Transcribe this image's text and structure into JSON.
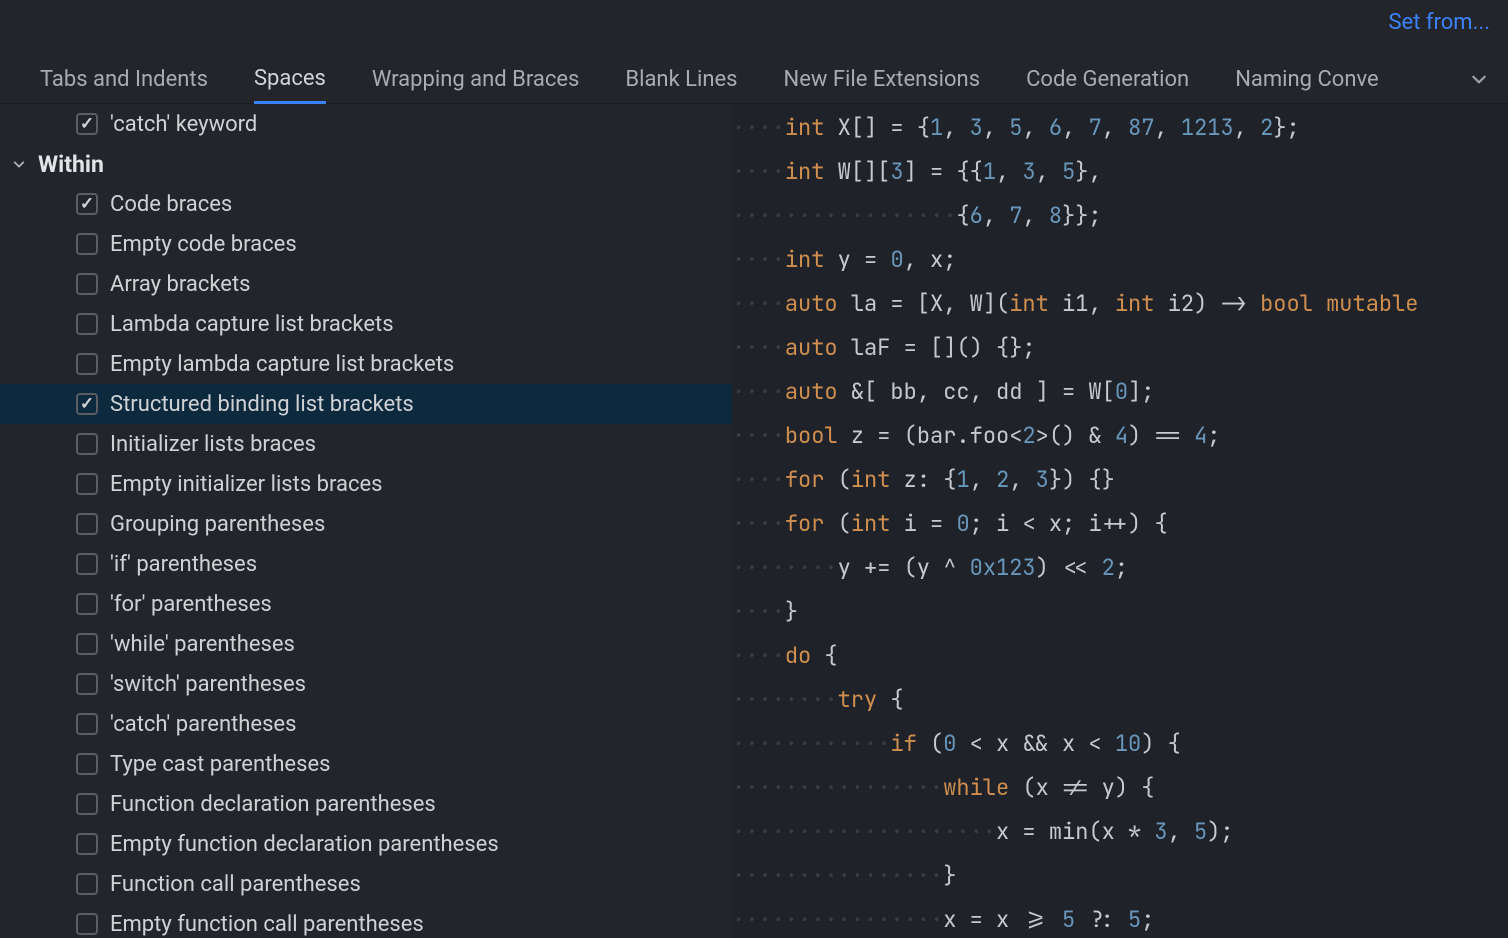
{
  "top_link": "Set from...",
  "tabs": [
    {
      "label": "Tabs and Indents",
      "active": false
    },
    {
      "label": "Spaces",
      "active": true
    },
    {
      "label": "Wrapping and Braces",
      "active": false
    },
    {
      "label": "Blank Lines",
      "active": false
    },
    {
      "label": "New File Extensions",
      "active": false
    },
    {
      "label": "Code Generation",
      "active": false
    },
    {
      "label": "Naming Conve",
      "active": false
    }
  ],
  "pre_section_option": {
    "label": "'catch' keyword",
    "checked": true
  },
  "section": {
    "label": "Within"
  },
  "options": [
    {
      "label": "Code braces",
      "checked": true,
      "selected": false
    },
    {
      "label": "Empty code braces",
      "checked": false,
      "selected": false
    },
    {
      "label": "Array brackets",
      "checked": false,
      "selected": false
    },
    {
      "label": "Lambda capture list brackets",
      "checked": false,
      "selected": false
    },
    {
      "label": "Empty lambda capture list brackets",
      "checked": false,
      "selected": false
    },
    {
      "label": "Structured binding list brackets",
      "checked": true,
      "selected": true
    },
    {
      "label": "Initializer lists braces",
      "checked": false,
      "selected": false
    },
    {
      "label": "Empty initializer lists braces",
      "checked": false,
      "selected": false
    },
    {
      "label": "Grouping parentheses",
      "checked": false,
      "selected": false
    },
    {
      "label": "'if' parentheses",
      "checked": false,
      "selected": false
    },
    {
      "label": "'for' parentheses",
      "checked": false,
      "selected": false
    },
    {
      "label": "'while' parentheses",
      "checked": false,
      "selected": false
    },
    {
      "label": "'switch' parentheses",
      "checked": false,
      "selected": false
    },
    {
      "label": "'catch' parentheses",
      "checked": false,
      "selected": false
    },
    {
      "label": "Type cast parentheses",
      "checked": false,
      "selected": false
    },
    {
      "label": "Function declaration parentheses",
      "checked": false,
      "selected": false
    },
    {
      "label": "Empty function declaration parentheses",
      "checked": false,
      "selected": false
    },
    {
      "label": "Function call parentheses",
      "checked": false,
      "selected": false
    },
    {
      "label": "Empty function call parentheses",
      "checked": false,
      "selected": false
    }
  ],
  "code": [
    [
      {
        "ws": "····"
      },
      {
        "kw": "int"
      },
      {
        "pn": " X[] = {"
      },
      {
        "nm": "1"
      },
      {
        "pn": ", "
      },
      {
        "nm": "3"
      },
      {
        "pn": ", "
      },
      {
        "nm": "5"
      },
      {
        "pn": ", "
      },
      {
        "nm": "6"
      },
      {
        "pn": ", "
      },
      {
        "nm": "7"
      },
      {
        "pn": ", "
      },
      {
        "nm": "87"
      },
      {
        "pn": ", "
      },
      {
        "nm": "1213"
      },
      {
        "pn": ", "
      },
      {
        "nm": "2"
      },
      {
        "pn": "};"
      }
    ],
    [
      {
        "ws": "····"
      },
      {
        "kw": "int"
      },
      {
        "pn": " W[]["
      },
      {
        "nm": "3"
      },
      {
        "pn": "] = {{"
      },
      {
        "nm": "1"
      },
      {
        "pn": ", "
      },
      {
        "nm": "3"
      },
      {
        "pn": ", "
      },
      {
        "nm": "5"
      },
      {
        "pn": "},"
      }
    ],
    [
      {
        "ws": "·················"
      },
      {
        "pn": "{"
      },
      {
        "nm": "6"
      },
      {
        "pn": ", "
      },
      {
        "nm": "7"
      },
      {
        "pn": ", "
      },
      {
        "nm": "8"
      },
      {
        "pn": "}};"
      }
    ],
    [
      {
        "ws": "····"
      },
      {
        "kw": "int"
      },
      {
        "pn": " y = "
      },
      {
        "nm": "0"
      },
      {
        "pn": ", x;"
      }
    ],
    [
      {
        "ws": "····"
      },
      {
        "kw": "auto"
      },
      {
        "pn": " la = [X, W]("
      },
      {
        "kw": "int"
      },
      {
        "pn": " i1, "
      },
      {
        "kw": "int"
      },
      {
        "pn": " i2) -> "
      },
      {
        "kw": "bool"
      },
      {
        "pn": " "
      },
      {
        "kw": "mutable"
      }
    ],
    [
      {
        "ws": "····"
      },
      {
        "kw": "auto"
      },
      {
        "pn": " laF = []() {};"
      }
    ],
    [
      {
        "ws": "····"
      },
      {
        "kw": "auto"
      },
      {
        "pn": " &[ bb, cc, dd ] = W["
      },
      {
        "nm": "0"
      },
      {
        "pn": "];"
      }
    ],
    [
      {
        "ws": "····"
      },
      {
        "kw": "bool"
      },
      {
        "pn": " z = (bar.foo<"
      },
      {
        "nm": "2"
      },
      {
        "pn": ">() & "
      },
      {
        "nm": "4"
      },
      {
        "pn": ") == "
      },
      {
        "nm": "4"
      },
      {
        "pn": ";"
      }
    ],
    [
      {
        "ws": "····"
      },
      {
        "kw": "for"
      },
      {
        "pn": " ("
      },
      {
        "kw": "int"
      },
      {
        "pn": " z: {"
      },
      {
        "nm": "1"
      },
      {
        "pn": ", "
      },
      {
        "nm": "2"
      },
      {
        "pn": ", "
      },
      {
        "nm": "3"
      },
      {
        "pn": "}) {}"
      }
    ],
    [
      {
        "ws": "····"
      },
      {
        "kw": "for"
      },
      {
        "pn": " ("
      },
      {
        "kw": "int"
      },
      {
        "pn": " i = "
      },
      {
        "nm": "0"
      },
      {
        "pn": "; i < x; i++) {"
      }
    ],
    [
      {
        "ws": "········"
      },
      {
        "pn": "y += (y ^ "
      },
      {
        "nm": "0x123"
      },
      {
        "pn": ") << "
      },
      {
        "nm": "2"
      },
      {
        "pn": ";"
      }
    ],
    [
      {
        "ws": "····"
      },
      {
        "pn": "}"
      }
    ],
    [
      {
        "ws": "····"
      },
      {
        "kw": "do"
      },
      {
        "pn": " {"
      }
    ],
    [
      {
        "ws": "········"
      },
      {
        "kw": "try"
      },
      {
        "pn": " {"
      }
    ],
    [
      {
        "ws": "············"
      },
      {
        "kw": "if"
      },
      {
        "pn": " ("
      },
      {
        "nm": "0"
      },
      {
        "pn": " < x && x < "
      },
      {
        "nm": "10"
      },
      {
        "pn": ") {"
      }
    ],
    [
      {
        "ws": "················"
      },
      {
        "kw": "while"
      },
      {
        "pn": " (x != y) {"
      }
    ],
    [
      {
        "ws": "····················"
      },
      {
        "pn": "x = min(x * "
      },
      {
        "nm": "3"
      },
      {
        "pn": ", "
      },
      {
        "nm": "5"
      },
      {
        "pn": ");"
      }
    ],
    [
      {
        "ws": "················"
      },
      {
        "pn": "}"
      }
    ],
    [
      {
        "ws": "················"
      },
      {
        "pn": "x = x >= "
      },
      {
        "nm": "5"
      },
      {
        "pn": " ?: "
      },
      {
        "nm": "5"
      },
      {
        "pn": ";"
      }
    ]
  ]
}
